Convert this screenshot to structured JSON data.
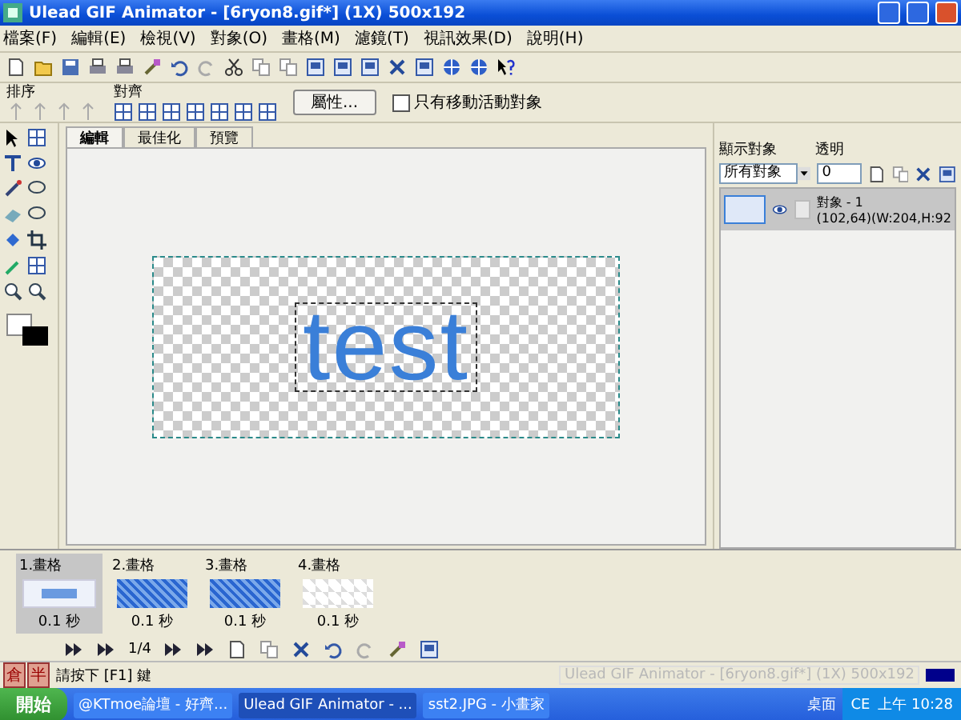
{
  "window": {
    "title": "Ulead GIF Animator - [6ryon8.gif*] (1X) 500x192"
  },
  "menu": [
    "檔案(F)",
    "編輯(E)",
    "檢視(V)",
    "對象(O)",
    "畫格(M)",
    "濾鏡(T)",
    "視訊效果(D)",
    "說明(H)"
  ],
  "toolbar2": {
    "sort_label": "排序",
    "align_label": "對齊",
    "properties_button": "屬性...",
    "only_move_active": {
      "label": "只有移動活動對象",
      "checked": false
    }
  },
  "tabs": [
    {
      "label": "編輯",
      "selected": true
    },
    {
      "label": "最佳化",
      "selected": false
    },
    {
      "label": "預覽",
      "selected": false
    }
  ],
  "canvas": {
    "text": "test"
  },
  "object_panel": {
    "show_label": "顯示對象",
    "opacity_label": "透明",
    "show_value": "所有對象",
    "opacity_value": "0",
    "objects": [
      {
        "name": "對象 - 1",
        "info": "(102,64)(W:204,H:92",
        "visible": true
      }
    ]
  },
  "frames": [
    {
      "label": "1.畫格",
      "delay": "0.1 秒",
      "kind": "text",
      "selected": true
    },
    {
      "label": "2.畫格",
      "delay": "0.1 秒",
      "kind": "pattern",
      "selected": false
    },
    {
      "label": "3.畫格",
      "delay": "0.1 秒",
      "kind": "pattern",
      "selected": false
    },
    {
      "label": "4.畫格",
      "delay": "0.1 秒",
      "kind": "blank",
      "selected": false
    }
  ],
  "frame_nav": {
    "counter": "1/4"
  },
  "ime": [
    "倉",
    "半"
  ],
  "status_bar": {
    "text": "請按下 [F1] 鍵",
    "tooltip": "Ulead GIF Animator - [6ryon8.gif*] (1X) 500x192"
  },
  "taskbar": {
    "start": "開始",
    "buttons": [
      {
        "label": "@KTmoe論壇 - 好齊...",
        "selected": false
      },
      {
        "label": "Ulead GIF Animator - ...",
        "selected": true
      },
      {
        "label": "sst2.JPG - 小畫家",
        "selected": false
      }
    ],
    "desktop": "桌面",
    "ime": "CE",
    "clock": "上午 10:28"
  }
}
